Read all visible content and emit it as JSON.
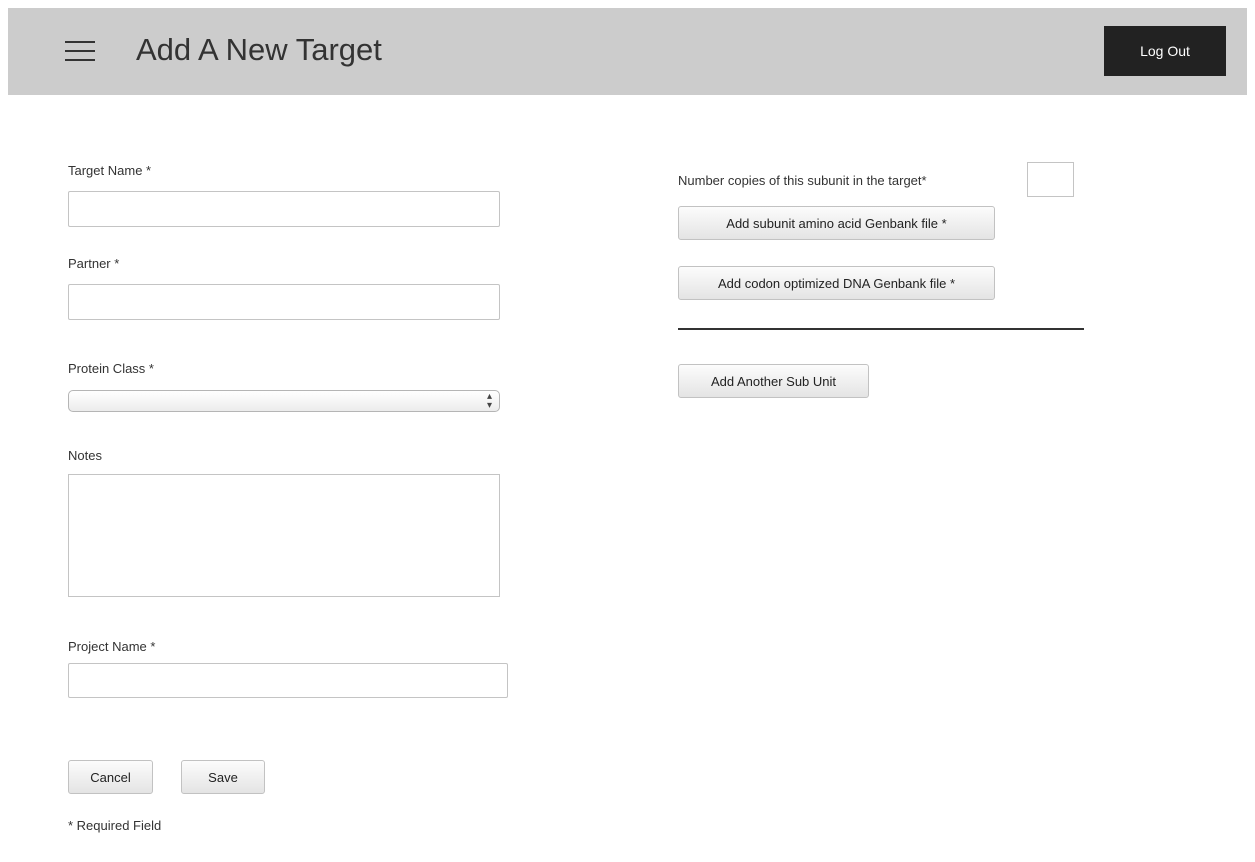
{
  "header": {
    "title": "Add A New Target",
    "logout_label": "Log Out",
    "menu_icon": "hamburger-menu-icon"
  },
  "form": {
    "target_name": {
      "label": "Target Name *",
      "value": ""
    },
    "partner": {
      "label": "Partner *",
      "value": ""
    },
    "protein_class": {
      "label": "Protein Class *",
      "selected": ""
    },
    "notes": {
      "label": "Notes",
      "value": ""
    },
    "project_name": {
      "label": "Project Name *",
      "value": ""
    },
    "cancel_label": "Cancel",
    "save_label": "Save",
    "required_note": "* Required Field"
  },
  "subunit": {
    "copies_label": "Number copies of this subunit in the target*",
    "copies_value": "",
    "add_amino_acid_label": "Add subunit amino acid Genbank file *",
    "add_dna_label": "Add codon optimized DNA Genbank file *",
    "add_another_label": "Add Another Sub Unit"
  },
  "colors": {
    "header_bg": "#cccccc",
    "logout_bg": "#222222",
    "logout_text": "#ffffff"
  }
}
